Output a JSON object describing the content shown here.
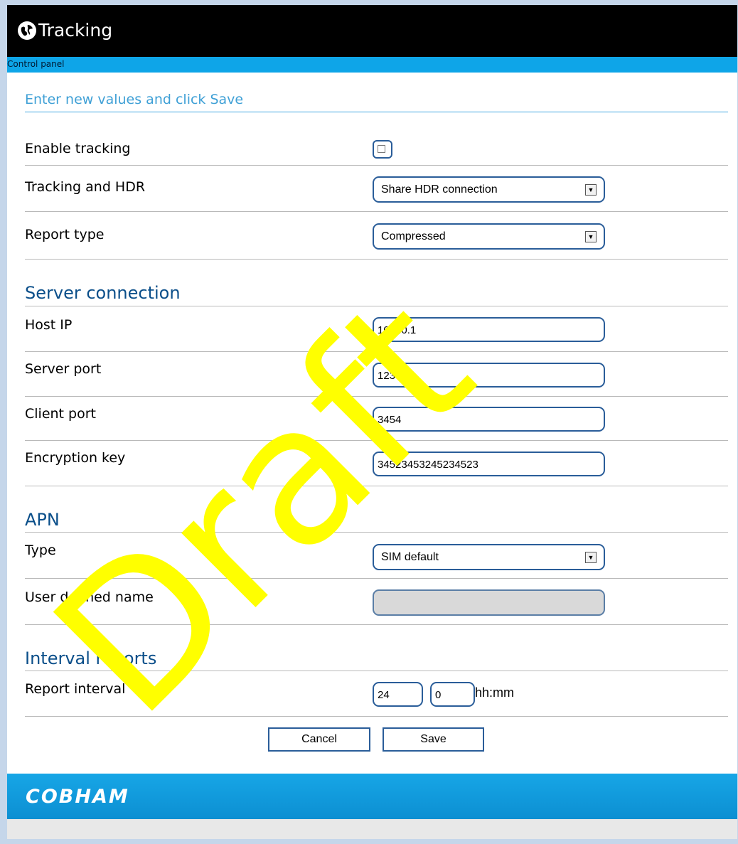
{
  "window": {
    "title": "Tracking",
    "breadcrumb": "Control panel"
  },
  "form": {
    "intro": "Enter new values and click Save",
    "enable_tracking": {
      "label": "Enable tracking",
      "checked": false
    },
    "tracking_hdr": {
      "label": "Tracking and HDR",
      "value": "Share HDR connection"
    },
    "report_type": {
      "label": "Report type",
      "value": "Compressed"
    },
    "server_connection": {
      "heading": "Server connection",
      "host_ip": {
        "label": "Host IP",
        "value": "10.0.0.1"
      },
      "server_port": {
        "label": "Server port",
        "value": "1234"
      },
      "client_port": {
        "label": "Client port",
        "value": "3454"
      },
      "encryption_key": {
        "label": "Encryption key",
        "value": "34523453245234523"
      }
    },
    "apn": {
      "heading": "APN",
      "type": {
        "label": "Type",
        "value": "SIM default"
      },
      "user_defined_name": {
        "label": "User defined name",
        "value": ""
      }
    },
    "interval_reports": {
      "heading": "Interval reports",
      "report_interval": {
        "label": "Report interval",
        "hours": "24",
        "minutes": "0",
        "unit": "hh:mm"
      }
    },
    "buttons": {
      "cancel": "Cancel",
      "save": "Save"
    }
  },
  "footer": {
    "brand": "COBHAM"
  },
  "watermark": "Draft",
  "colors": {
    "title_bar": "#000000",
    "accent": "#0ea5e8",
    "heading": "#0b4f8a",
    "intro": "#3fa0d6",
    "watermark": "#ffff00"
  },
  "icons": {
    "title": "globe-icon",
    "select_arrow": "dropdown-arrow-icon"
  }
}
